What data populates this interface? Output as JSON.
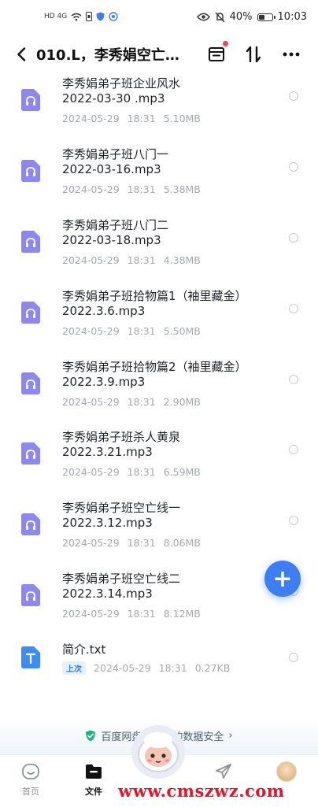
{
  "status_bar": {
    "left_indicators": "HD 4G",
    "battery": "40%",
    "time": "10:03"
  },
  "header": {
    "title": "010.L，李秀娟空亡…"
  },
  "files": [
    {
      "name_line1": "李秀娟弟子班企业风水",
      "name_line2": "2022-03-30 .mp3",
      "date": "2024-05-29",
      "time": "18:31",
      "size": "5.10MB",
      "icon": "audio-file-icon"
    },
    {
      "name_line1": "李秀娟弟子班八门一",
      "name_line2": "2022-03-16.mp3",
      "date": "2024-05-29",
      "time": "18:31",
      "size": "5.38MB",
      "icon": "audio-file-icon"
    },
    {
      "name_line1": "李秀娟弟子班八门二",
      "name_line2": "2022-03-18.mp3",
      "date": "2024-05-29",
      "time": "18:31",
      "size": "4.38MB",
      "icon": "audio-file-icon"
    },
    {
      "name_line1": "李秀娟弟子班拾物篇1（袖里藏金）",
      "name_line2": "2022.3.6.mp3",
      "date": "2024-05-29",
      "time": "18:31",
      "size": "5.50MB",
      "icon": "audio-file-icon"
    },
    {
      "name_line1": "李秀娟弟子班拾物篇2（袖里藏金）",
      "name_line2": "2022.3.9.mp3",
      "date": "2024-05-29",
      "time": "18:31",
      "size": "2.90MB",
      "icon": "audio-file-icon"
    },
    {
      "name_line1": "李秀娟弟子班杀人黄泉",
      "name_line2": "2022.3.21.mp3",
      "date": "2024-05-29",
      "time": "18:31",
      "size": "6.59MB",
      "icon": "audio-file-icon"
    },
    {
      "name_line1": "李秀娟弟子班空亡线一",
      "name_line2": "2022.3.12.mp3",
      "date": "2024-05-29",
      "time": "18:31",
      "size": "8.06MB",
      "icon": "audio-file-icon"
    },
    {
      "name_line1": "李秀娟弟子班空亡线二",
      "name_line2": "2022.3.14.mp3",
      "date": "2024-05-29",
      "time": "18:31",
      "size": "8.12MB",
      "icon": "audio-file-icon"
    }
  ],
  "text_file": {
    "name": "简介.txt",
    "badge": "上次",
    "date": "2024-05-29",
    "time": "18:31",
    "size": "0.27KB",
    "icon": "text-file-icon"
  },
  "fab": {
    "label": "+"
  },
  "security_banner": {
    "text": "百度网盘保障你的数据安全",
    "chevron": "›"
  },
  "bottom_nav": {
    "home": "首页",
    "files": "文件"
  },
  "watermark": "www.cmszwz.com",
  "colors": {
    "accent": "#3b7ef6",
    "audio_icon": "#8e87ef",
    "text_icon": "#3d8cf5",
    "meta_gray": "#a4a8b0",
    "notification_dot": "#f0445b",
    "watermark": "#e8142b"
  }
}
